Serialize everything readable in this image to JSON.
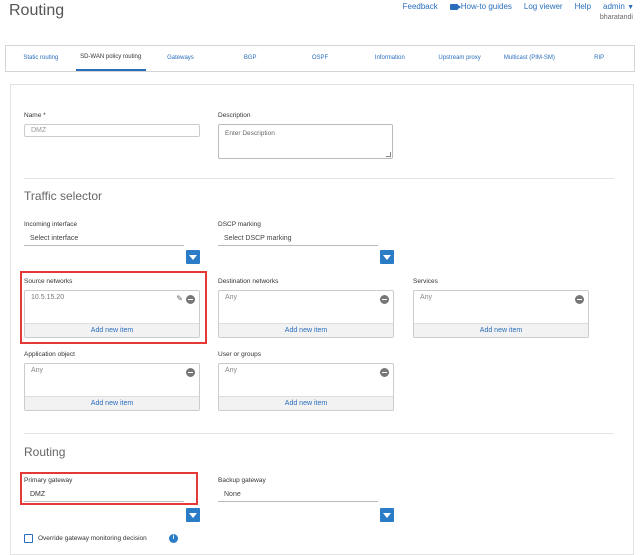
{
  "page": {
    "title": "Routing"
  },
  "toplinks": {
    "feedback": "Feedback",
    "howto": "How-to guides",
    "logviewer": "Log viewer",
    "help": "Help",
    "admin": "admin",
    "user": "bharatandi"
  },
  "tabs": [
    {
      "label": "Static routing"
    },
    {
      "label": "SD-WAN policy routing"
    },
    {
      "label": "Gateways"
    },
    {
      "label": "BGP"
    },
    {
      "label": "OSPF"
    },
    {
      "label": "Information"
    },
    {
      "label": "Upstream proxy"
    },
    {
      "label": "Multicast (PIM-SM)"
    },
    {
      "label": "RIP"
    }
  ],
  "form": {
    "name_label": "Name *",
    "name_value": "DMZ",
    "description_label": "Description",
    "description_placeholder": "Enter Description",
    "traffic_selector_title": "Traffic selector",
    "incoming_label": "Incoming interface",
    "incoming_value": "Select interface",
    "dscp_label": "DSCP marking",
    "dscp_value": "Select DSCP marking",
    "source_label": "Source networks",
    "source_item": "10.5.15.20",
    "dest_label": "Destination networks",
    "dest_item": "Any",
    "services_label": "Services",
    "services_item": "Any",
    "app_label": "Application object",
    "app_item": "Any",
    "user_label": "User or groups",
    "user_item": "Any",
    "add_new": "Add new item",
    "routing_title": "Routing",
    "primary_label": "Primary gateway",
    "primary_value": "DMZ",
    "backup_label": "Backup gateway",
    "backup_value": "None",
    "override_label": "Override gateway monitoring decision"
  },
  "colors": {
    "accent": "#2a7cc7",
    "highlight": "#e53935",
    "link": "#2a6ebb"
  }
}
